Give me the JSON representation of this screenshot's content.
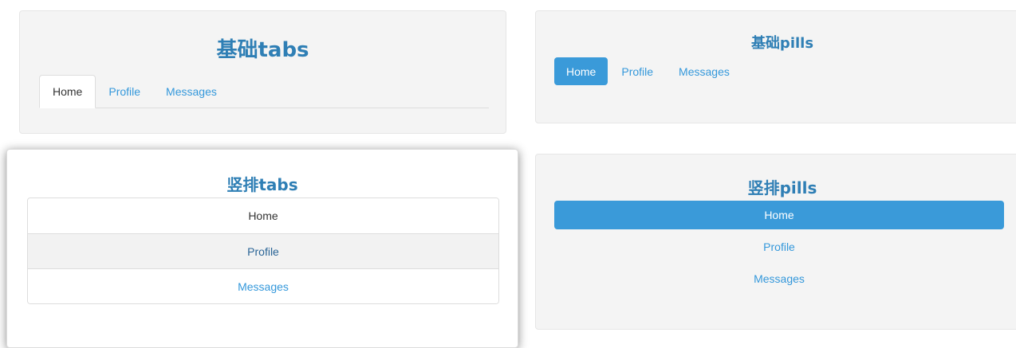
{
  "basic_tabs": {
    "title": "基础tabs",
    "items": [
      "Home",
      "Profile",
      "Messages"
    ]
  },
  "basic_pills": {
    "title": "基础pills",
    "items": [
      "Home",
      "Profile",
      "Messages"
    ]
  },
  "stacked_tabs": {
    "title": "竖排tabs",
    "items": [
      "Home",
      "Profile",
      "Messages"
    ]
  },
  "stacked_pills": {
    "title": "竖排pills",
    "items": [
      "Home",
      "Profile",
      "Messages"
    ]
  },
  "colors": {
    "accent": "#3a9ad9",
    "link": "#3498db",
    "title": "#2f7fb5"
  }
}
